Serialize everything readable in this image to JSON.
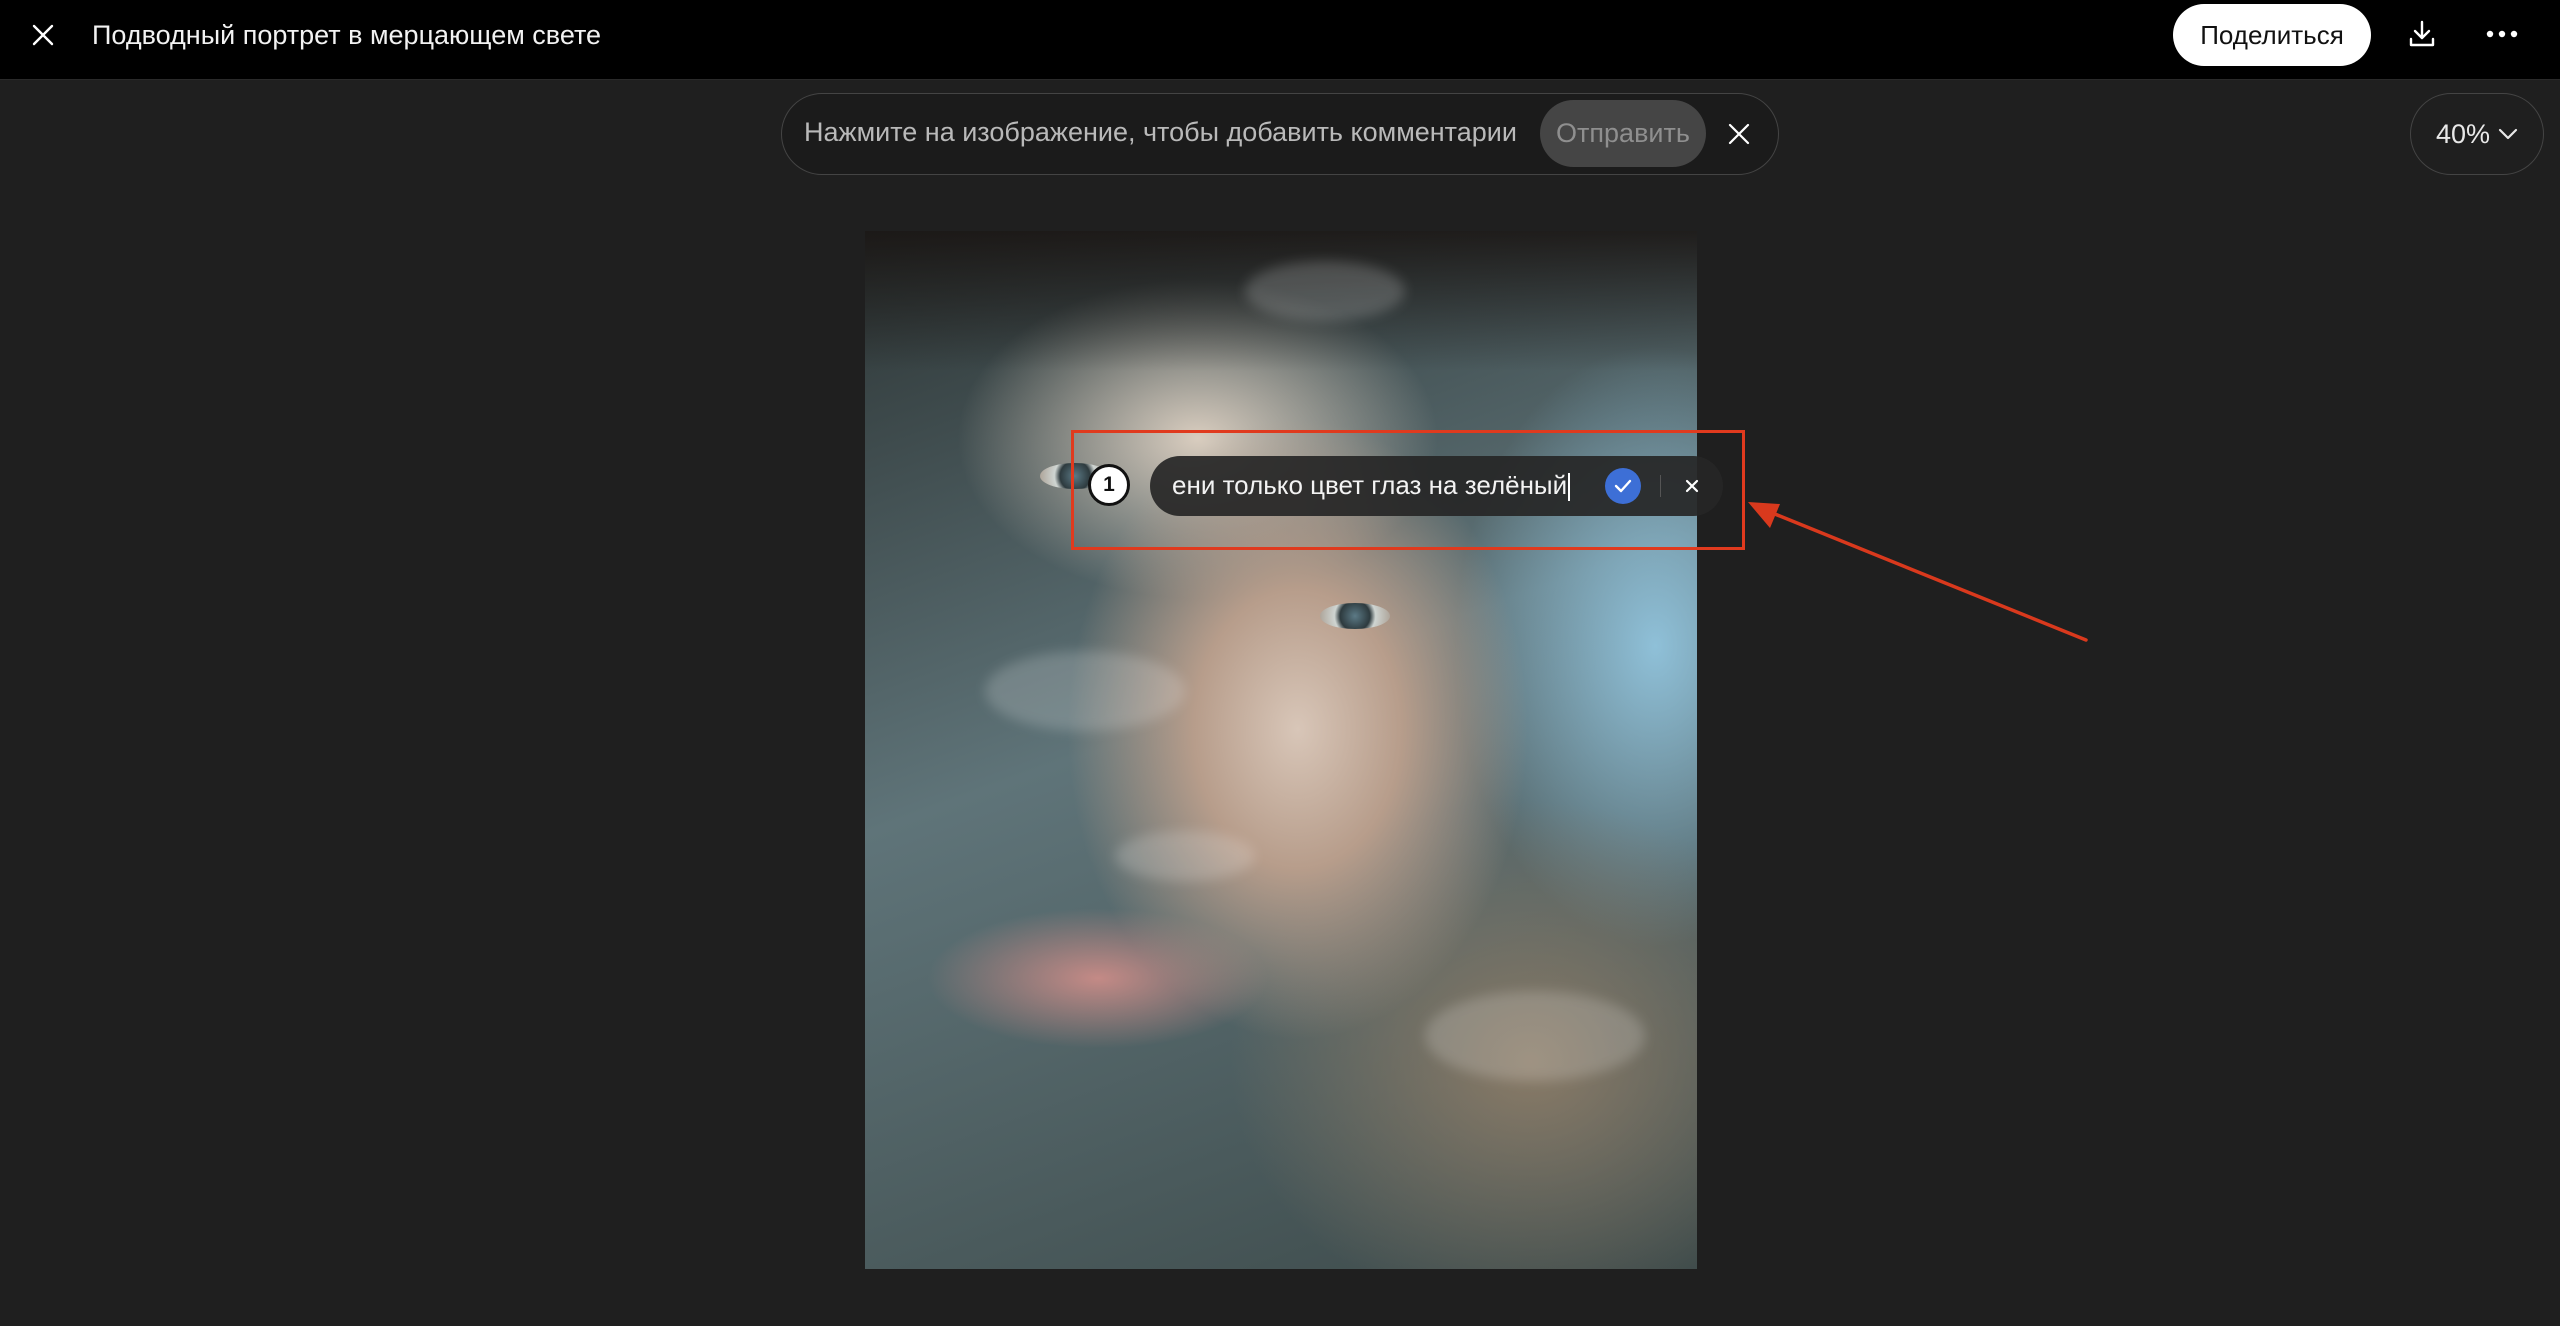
{
  "header": {
    "title": "Подводный портрет в мерцающем свете",
    "share_label": "Поделиться",
    "close_icon": "close-icon",
    "download_icon": "download-icon",
    "more_icon": "more-horizontal-icon"
  },
  "comment_bar": {
    "hint": "Нажмите на изображение, чтобы добавить комментарии",
    "send_label": "Отправить",
    "close_icon": "close-icon"
  },
  "zoom": {
    "value": "40%",
    "icon": "chevron-down-icon"
  },
  "annotation": {
    "pin_number": "1",
    "text": "ени только цвет глаз на зелёный",
    "confirm_icon": "check-icon",
    "dismiss_icon": "close-icon"
  },
  "colors": {
    "highlight": "#e03a1e",
    "confirm": "#3d6fd6",
    "background": "#1f1f1f",
    "topbar": "#000000"
  }
}
